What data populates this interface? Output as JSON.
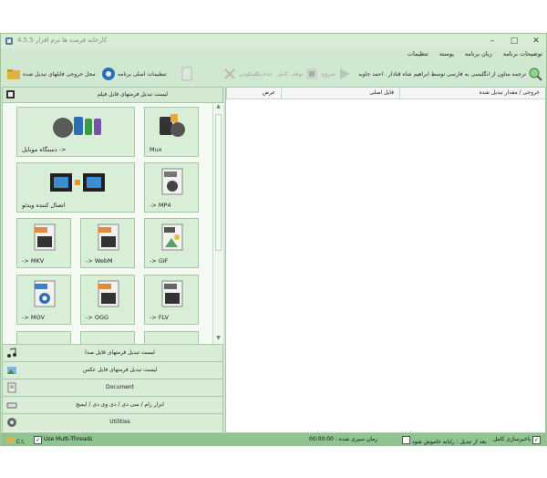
{
  "window": {
    "title": "کارخانه فرمت ها نرم افزار 4.5.5",
    "minimize": "–",
    "maximize": "□",
    "close": "✕"
  },
  "menu": {
    "items": [
      "توضیحات برنامه",
      "زبان برنامه",
      "پوسته",
      "تنظیمات"
    ]
  },
  "toolbar": {
    "credit": "ترجمه متاون از انگلیسی به فارسی توسط ابراهیم شاه قنادار . احمد جاوید",
    "buttons": [
      {
        "label": "توقف کامل",
        "enabled": false,
        "icon": "stop-icon"
      },
      {
        "label": "شروع",
        "enabled": false,
        "icon": "start-icon"
      },
      {
        "label": "حذف لیست",
        "enabled": false,
        "icon": "clear-list-icon"
      },
      {
        "label": "پاک کردن",
        "enabled": false,
        "icon": "delete-icon"
      },
      {
        "label": "",
        "enabled": false,
        "icon": "document-icon"
      },
      {
        "label": "تنظیمات اصلی برنامه",
        "enabled": true,
        "icon": "settings-disc-icon"
      },
      {
        "label": "محل خروجی فایلهای تبدیل شده",
        "enabled": true,
        "icon": "output-folder-icon"
      }
    ]
  },
  "left_pane": {
    "header": "لیست تبدیل فرمتهای فایل فیلم",
    "tiles": [
      {
        "caption": "Mux",
        "icon": "mux-icon"
      },
      {
        "caption": "دستگاه موبایل ->",
        "icon": "mobile-device-icon"
      },
      {
        "caption": "-> MP4",
        "icon": "mp4-icon"
      },
      {
        "caption": "اتصال کننده ویدئو",
        "icon": "video-joiner-icon"
      },
      {
        "caption": "-> GIF",
        "icon": "gif-icon"
      },
      {
        "caption": "-> WebM",
        "icon": "webm-icon"
      },
      {
        "caption": "-> MKV",
        "icon": "mkv-icon"
      },
      {
        "caption": "-> FLV",
        "icon": "flv-icon"
      },
      {
        "caption": "-> OGG",
        "icon": "ogg-icon"
      },
      {
        "caption": "-> MOV",
        "icon": "mov-icon"
      }
    ],
    "categories": [
      {
        "label": "لیست تبدیل فرمتهای فایل صدا",
        "icon": "audio-icon"
      },
      {
        "label": "لیست تبدیل فرمتهای فایل عکس",
        "icon": "picture-icon"
      },
      {
        "label": "Document",
        "icon": "document-icon"
      },
      {
        "label": "ابزار رام / سی دی / دی وی دی / ایمیج",
        "icon": "disc-drive-icon"
      },
      {
        "label": "Utilities",
        "icon": "utilities-icon"
      }
    ]
  },
  "file_list": {
    "columns": [
      "خروجی / مقدار تبدیل شده",
      "فایل اصلی",
      "عرض"
    ]
  },
  "statusbar": {
    "path": "C:\\",
    "multithreads_label": "Use Multi-Threads",
    "multithreads_checked": true,
    "notify_label": "باخبرسازی کامل",
    "after_convert_label": "بعد از تبدیل : رایانه خاموش شود",
    "elapsed_label": "زمان سپری شده :",
    "elapsed_value": "00:00:00"
  }
}
